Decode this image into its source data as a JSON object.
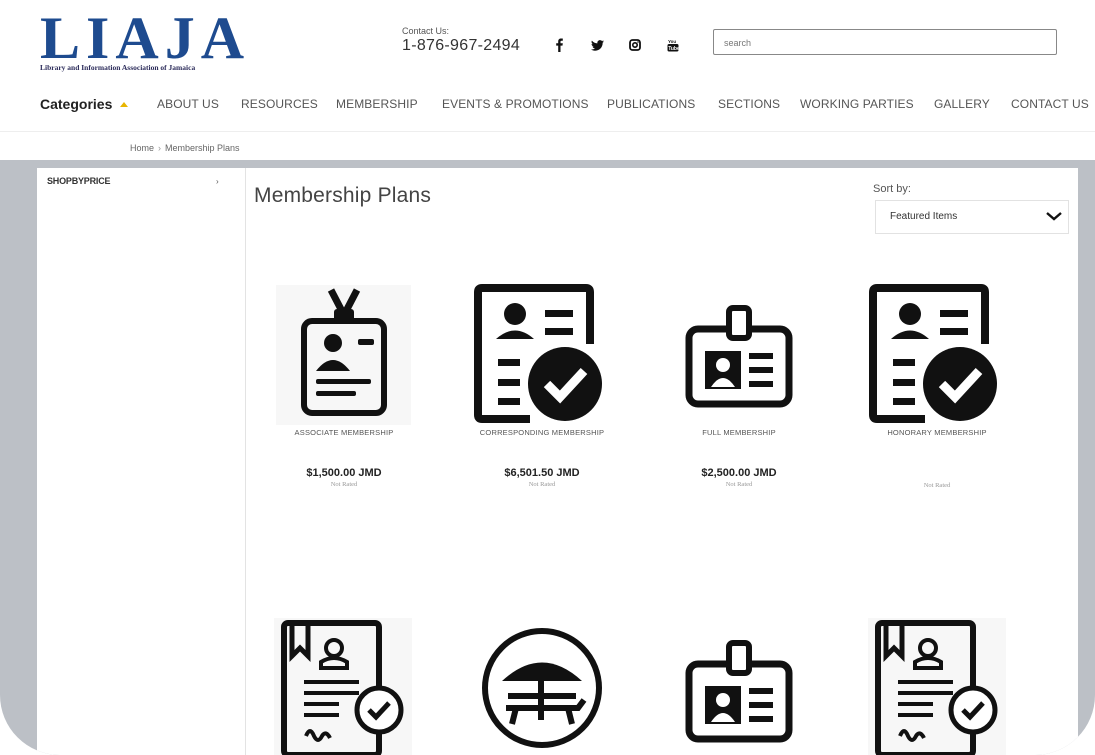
{
  "header": {
    "logo_text": "LIAJA",
    "logo_subtitle": "Library and Information Association of Jamaica",
    "contact_label": "Contact Us:",
    "contact_phone": "1-876-967-2494",
    "social_icons": [
      "facebook-icon",
      "twitter-icon",
      "instagram-icon",
      "youtube-icon"
    ],
    "search_placeholder": "search"
  },
  "nav": {
    "categories_label": "Categories",
    "items": [
      "ABOUT US",
      "RESOURCES",
      "MEMBERSHIP",
      "EVENTS & PROMOTIONS",
      "PUBLICATIONS",
      "SECTIONS",
      "WORKING PARTIES",
      "GALLERY",
      "CONTACT US"
    ]
  },
  "breadcrumb": {
    "home": "Home",
    "current": "Membership Plans"
  },
  "sidebar": {
    "title": "SHOPBYPRICE"
  },
  "main": {
    "title": "Membership Plans",
    "sort_label": "Sort by:",
    "sort_value": "Featured Items"
  },
  "products": [
    {
      "name": "ASSOCIATE MEMBERSHIP",
      "price": "$1,500.00 JMD",
      "rating": "Not Rated",
      "icon": "badge-lanyard-icon"
    },
    {
      "name": "CORRESPONDING MEMBERSHIP",
      "price": "$6,501.50 JMD",
      "rating": "Not Rated",
      "icon": "profile-document-check-icon"
    },
    {
      "name": "FULL MEMBERSHIP",
      "price": "$2,500.00 JMD",
      "rating": "Not Rated",
      "icon": "id-badge-icon"
    },
    {
      "name": "HONORARY MEMBERSHIP",
      "price": "",
      "rating": "Not Rated",
      "icon": "profile-document-check-icon"
    },
    {
      "name": "",
      "price": "",
      "rating": "",
      "icon": "certificate-check-icon"
    },
    {
      "name": "",
      "price": "",
      "rating": "",
      "icon": "beach-umbrella-icon"
    },
    {
      "name": "",
      "price": "",
      "rating": "",
      "icon": "id-badge-icon"
    },
    {
      "name": "",
      "price": "",
      "rating": "",
      "icon": "certificate-check-icon"
    }
  ],
  "colors": {
    "logo_blue": "#1e4b8f",
    "accent_caret": "#e8b500",
    "page_band": "#bcc0c6"
  }
}
